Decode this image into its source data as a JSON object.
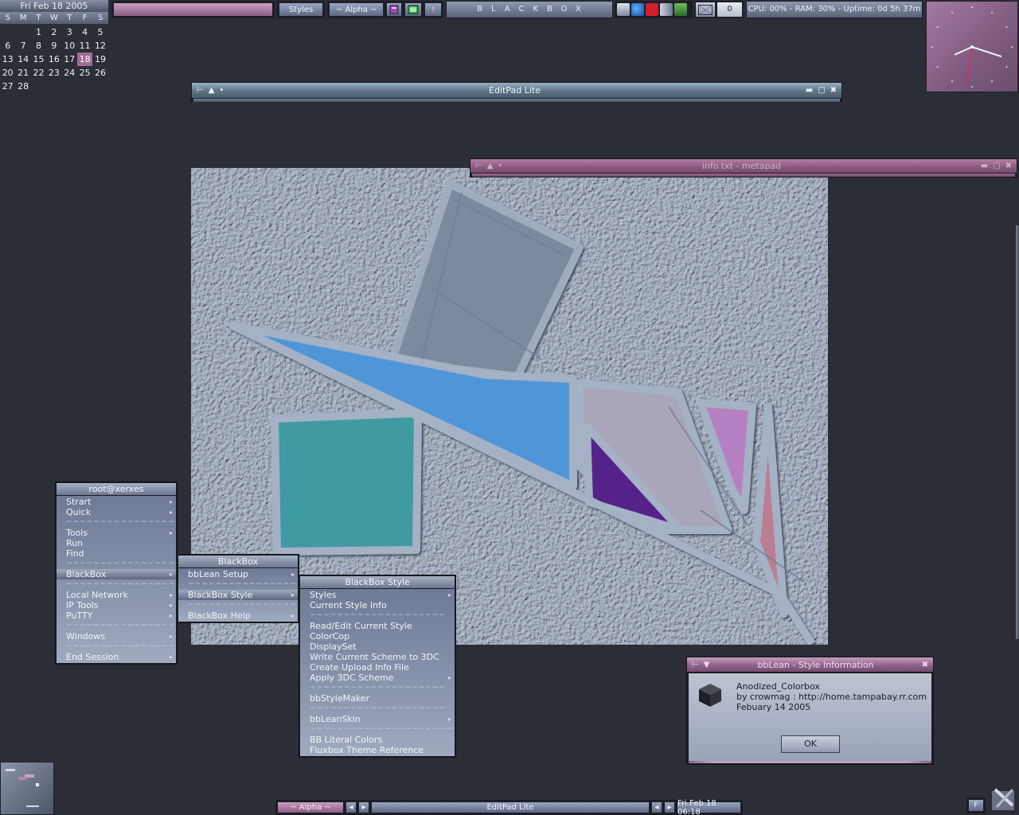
{
  "calendar": {
    "title": "Fri Feb 18  2005",
    "weekdays": [
      "S",
      "M",
      "T",
      "W",
      "T",
      "F",
      "S"
    ],
    "rows": [
      [
        "",
        "",
        "1",
        "2",
        "3",
        "4",
        "5"
      ],
      [
        "6",
        "7",
        "8",
        "9",
        "10",
        "11",
        "12"
      ],
      [
        "13",
        "14",
        "15",
        "16",
        "17",
        "18",
        "19"
      ],
      [
        "20",
        "21",
        "22",
        "23",
        "24",
        "25",
        "26"
      ],
      [
        "27",
        "28",
        "",
        "",
        "",
        "",
        ""
      ]
    ],
    "today": "18"
  },
  "toolbar": {
    "styles_label": "Styles",
    "alpha_label": "~ Alpha ~",
    "alert_label": "!",
    "title": "BLACKBOX",
    "mail_count": "0",
    "sysmon": "CPU: 00% - RAM: 30% - Uptime: 0d 5h 37m"
  },
  "clock": {
    "hour_deg": 246,
    "minute_deg": 108,
    "second_deg": 190
  },
  "editpad": {
    "title": "EditPad Lite"
  },
  "metapad": {
    "title": "info.txt - metapad"
  },
  "root_menu": {
    "title": "root@xerxes",
    "items": [
      {
        "label": "Strart",
        "sub": true
      },
      {
        "label": "Quick",
        "sub": true
      },
      {
        "label": "~~~~~~~~~~~~~~~~~~~~",
        "sep": true
      },
      {
        "label": "Tools",
        "sub": true
      },
      {
        "label": "Run"
      },
      {
        "label": "Find"
      },
      {
        "label": "~~~~~~~~~~~~~~~~~~~~",
        "sep": true
      },
      {
        "label": "BlackBox",
        "sub": true,
        "sel": true
      },
      {
        "label": "~~~~~~~~~~~~~~~~~~~~",
        "sep": true
      },
      {
        "label": "Local Network",
        "sub": true
      },
      {
        "label": "IP Tools",
        "sub": true
      },
      {
        "label": "PuTTY",
        "sub": true
      },
      {
        "label": "~~~~~~~~~~~~~~~~~~~~",
        "sep": true
      },
      {
        "label": "Windows",
        "sub": true
      },
      {
        "label": "~~~~~~~~~~~~~~~~~~~~",
        "sep": true
      },
      {
        "label": "End Session",
        "sub": true
      }
    ]
  },
  "bb_menu": {
    "title": "BlackBox",
    "items": [
      {
        "label": "bbLean Setup",
        "sub": true
      },
      {
        "label": "~~~~~~~~~~~~~~~~~~~~",
        "sep": true
      },
      {
        "label": "BlackBox Style",
        "sub": true,
        "sel": true
      },
      {
        "label": "~~~~~~~~~~~~~~~~~~~~",
        "sep": true
      },
      {
        "label": "BlackBox Help",
        "sub": true
      }
    ]
  },
  "style_menu": {
    "title": "BlackBox Style",
    "items": [
      {
        "label": "Styles",
        "sub": true
      },
      {
        "label": "Current Style Info"
      },
      {
        "label": "~~~~~~~~~~~~~~~~~~~~",
        "sep": true
      },
      {
        "label": "Read/Edit Current Style"
      },
      {
        "label": "ColorCop"
      },
      {
        "label": "DisplaySet"
      },
      {
        "label": "Write Current Scheme to 3DC"
      },
      {
        "label": "Create Upload Info File"
      },
      {
        "label": "Apply 3DC Scheme",
        "sub": true
      },
      {
        "label": "~~~~~~~~~~~~~~~~~~~~",
        "sep": true
      },
      {
        "label": "bbStyleMaker"
      },
      {
        "label": "~~~~~~~~~~~~~~~~~~~~",
        "sep": true
      },
      {
        "label": "bbLeanSkin",
        "sub": true
      },
      {
        "label": "~~~~~~~~~~~~~~~~~~~~~~",
        "sep": true
      },
      {
        "label": "BB Literal Colors"
      },
      {
        "label": "Fluxbox Theme Reference"
      }
    ]
  },
  "dialog": {
    "title": "bbLean - Style Information",
    "style_name": "Anodized_Colorbox",
    "author": "by crowmag : http://home.tampabay.rr.com",
    "date": "Febuary 14 2005",
    "ok_label": "OK"
  },
  "bottombar": {
    "alpha_label": "~ Alpha ~",
    "task_label": "EditPad Lite",
    "datetime": "Fri Feb 18 06:18"
  },
  "sys": {
    "f_label": "F"
  }
}
